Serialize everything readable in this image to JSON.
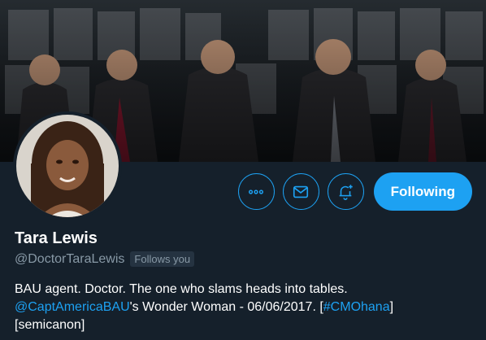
{
  "profile": {
    "name": "Tara Lewis",
    "handle": "@DoctorTaraLewis",
    "follows_you": "Follows you",
    "bio_line1": "BAU agent. Doctor. The one who slams heads into tables.",
    "bio_mention": "@CaptAmericaBAU",
    "bio_mid": "'s Wonder Woman - 06/06/2017. [",
    "bio_hashtag": "#CMOhana",
    "bio_tail": "]",
    "bio_line3": "[semicanon]"
  },
  "actions": {
    "more_icon": "more-icon",
    "message_icon": "envelope-icon",
    "notify_icon": "bell-plus-icon",
    "following_label": "Following"
  },
  "colors": {
    "background": "#15202b",
    "accent": "#1da1f2",
    "muted_text": "#8899a6",
    "badge_bg": "#253341"
  }
}
